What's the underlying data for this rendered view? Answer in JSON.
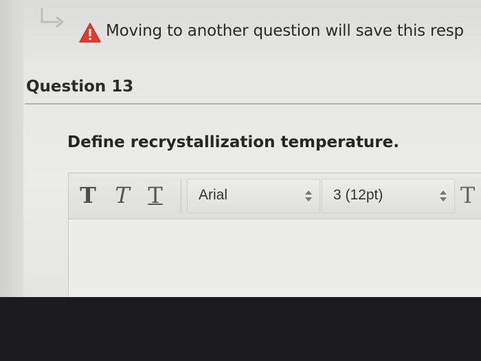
{
  "notice": {
    "text": "Moving to another question will save this resp"
  },
  "question": {
    "title": "Question 13",
    "prompt": "Define recrystallization temperature."
  },
  "editor": {
    "toolbar": {
      "bold_label": "T",
      "italic_label": "T",
      "underline_label": "T",
      "font_family_value": "Arial",
      "font_size_value": "3 (12pt)",
      "more_label": "T"
    },
    "answer_value": ""
  },
  "colors": {
    "warning": "#e23b2e",
    "arrow": "#b9b9b6",
    "screen_bg": "#e8e8e5",
    "bezel": "#1b1b1d"
  },
  "icons": [
    "return-arrow-icon",
    "warning-icon",
    "select-arrows-icon"
  ]
}
